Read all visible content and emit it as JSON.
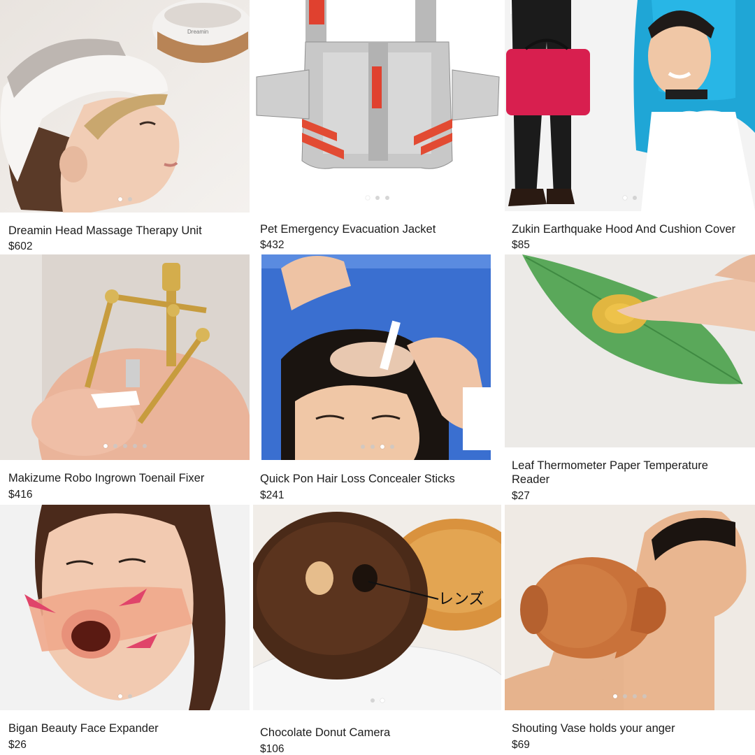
{
  "products": [
    {
      "title": "Dreamin Head Massage Therapy Unit",
      "price": "$602",
      "image": "head-massager-photo",
      "dots": 2,
      "active_dot": 0
    },
    {
      "title": "Pet Emergency Evacuation Jacket",
      "price": "$432",
      "image": "pet-evacuation-jacket-photo",
      "dots": 3,
      "active_dot": 0
    },
    {
      "title": "Zukin Earthquake Hood And Cushion Cover",
      "price": "$85",
      "image": "earthquake-hood-photo",
      "dots": 2,
      "active_dot": 0
    },
    {
      "title": "Makizume Robo Ingrown Toenail Fixer",
      "price": "$416",
      "image": "toenail-fixer-photo",
      "dots": 5,
      "active_dot": 0
    },
    {
      "title": "Quick Pon Hair Loss Concealer Sticks",
      "price": "$241",
      "image": "hair-concealer-photo",
      "dots": 4,
      "active_dot": 2
    },
    {
      "title": "Leaf Thermometer Paper Temperature Reader",
      "price": "$27",
      "image": "leaf-thermometer-photo",
      "dots": 0,
      "active_dot": 0
    },
    {
      "title": "Bigan Beauty Face Expander",
      "price": "$26",
      "image": "face-expander-photo",
      "dots": 2,
      "active_dot": 0
    },
    {
      "title": "Chocolate Donut Camera",
      "price": "$106",
      "image": "donut-camera-photo",
      "dots": 2,
      "active_dot": 1
    },
    {
      "title": "Shouting Vase holds your anger",
      "price": "$69",
      "image": "shouting-vase-photo",
      "dots": 4,
      "active_dot": 0
    }
  ],
  "image_text": {
    "massager_brand": "Dreamin",
    "donut_lens_label": "レンズ"
  },
  "colors": {
    "background": "#ffffff",
    "text": "#1c1c1c"
  }
}
